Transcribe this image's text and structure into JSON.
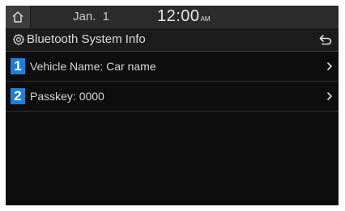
{
  "status": {
    "date": "Jan.  1",
    "time": "12:00",
    "ampm": "AM"
  },
  "header": {
    "title": "Bluetooth System Info",
    "title_icon": "gear-icon",
    "back_icon": "back-arrow-icon"
  },
  "list": {
    "items": [
      {
        "number": "1",
        "label": "Vehicle Name: Car name"
      },
      {
        "number": "2",
        "label": "Passkey: 0000"
      }
    ]
  },
  "colors": {
    "accent": "#1e7fd6",
    "background": "#0d0d0d",
    "status_bar": "#2b2b2b"
  }
}
